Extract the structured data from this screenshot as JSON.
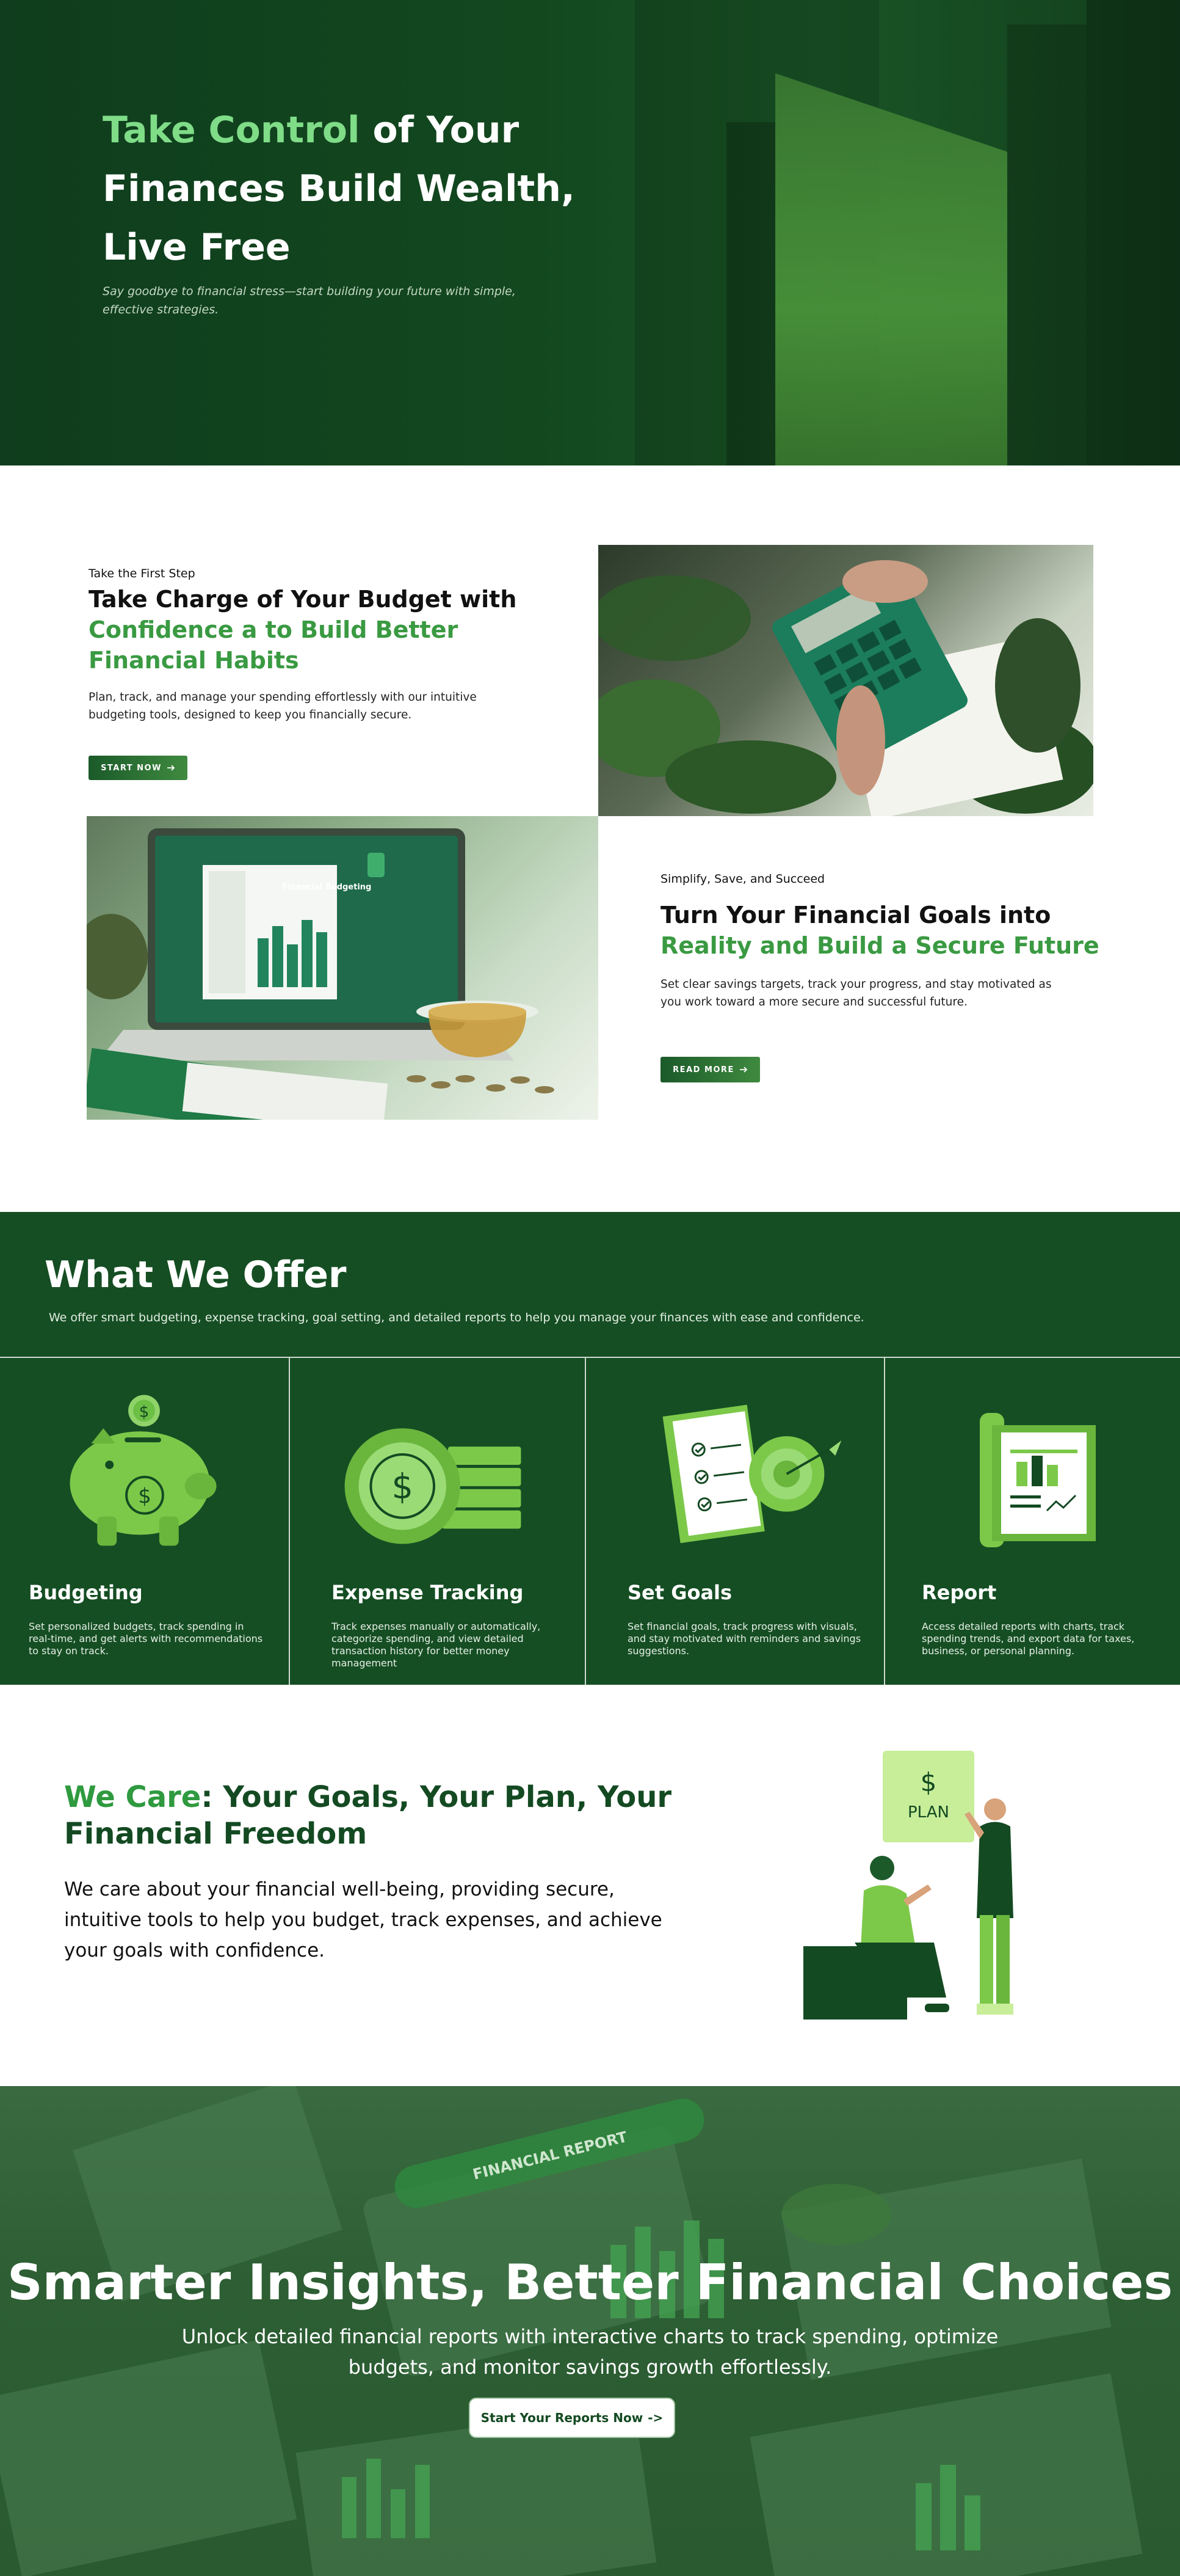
{
  "colors": {
    "dark_green": "#154e23",
    "accent_green": "#3a9a42",
    "light_green": "#7fdc87",
    "white": "#ffffff"
  },
  "hero": {
    "title_highlight": "Take Control",
    "title_rest": " of Your Finances Build Wealth, Live Free",
    "subtitle": "Say goodbye to financial stress—start building your future with simple, effective strategies."
  },
  "budget": {
    "kicker": "Take the First Step",
    "heading_plain": "Take Charge of Your Budget with",
    "heading_green": "Confidence a to Build Better Financial Habits",
    "body": "Plan, track, and manage your spending effortlessly with our intuitive budgeting tools, designed to keep you financially secure.",
    "button_label": "START NOW",
    "button_icon": "arrow-right-icon"
  },
  "goals": {
    "kicker": "Simplify, Save, and Succeed",
    "heading_plain": "Turn Your Financial Goals into",
    "heading_green": "Reality and Build a Secure Future",
    "body": "Set clear savings targets, track your progress, and stay motivated as you work toward a more secure and successful future.",
    "button_label": "READ MORE",
    "button_icon": "arrow-right-icon"
  },
  "laptop_screen": {
    "title": "Financial Budgeting"
  },
  "offer": {
    "heading": "What We Offer",
    "intro": "We offer smart budgeting, expense tracking, goal setting, and detailed reports to help you manage your finances with ease and confidence.",
    "cards": [
      {
        "title": "Budgeting",
        "description": "Set personalized budgets, track spending in real-time, and get alerts with recommendations to stay on track.",
        "icon": "piggy-bank-icon"
      },
      {
        "title": "Expense Tracking",
        "description": "Track expenses manually or automatically, categorize spending, and view detailed transaction history for better money management",
        "icon": "coins-icon"
      },
      {
        "title": "Set Goals",
        "description": "Set financial goals, track progress with visuals, and stay motivated with reminders and savings suggestions.",
        "icon": "target-checklist-icon"
      },
      {
        "title": "Report",
        "description": "Access detailed reports with charts, track spending trends, and export data for taxes, business, or personal planning.",
        "icon": "report-icon"
      }
    ]
  },
  "care": {
    "heading_green": "We Care",
    "heading_rest": ": Your Goals, Your Plan, Your Financial Freedom",
    "body": "We care about your financial well-being, providing secure, intuitive tools to help you budget, track expenses, and achieve your goals with confidence.",
    "illustration_sign": "PLAN",
    "illustration_symbol": "$"
  },
  "insights": {
    "heading": "Smarter Insights, Better Financial Choices",
    "body": "Unlock detailed financial reports with interactive charts to track spending, optimize budgets, and monitor savings growth effortlessly.",
    "button_label": "Start  Your Reports Now",
    "button_arrow": "->",
    "bg_label": "FINANCIAL REPORT"
  }
}
